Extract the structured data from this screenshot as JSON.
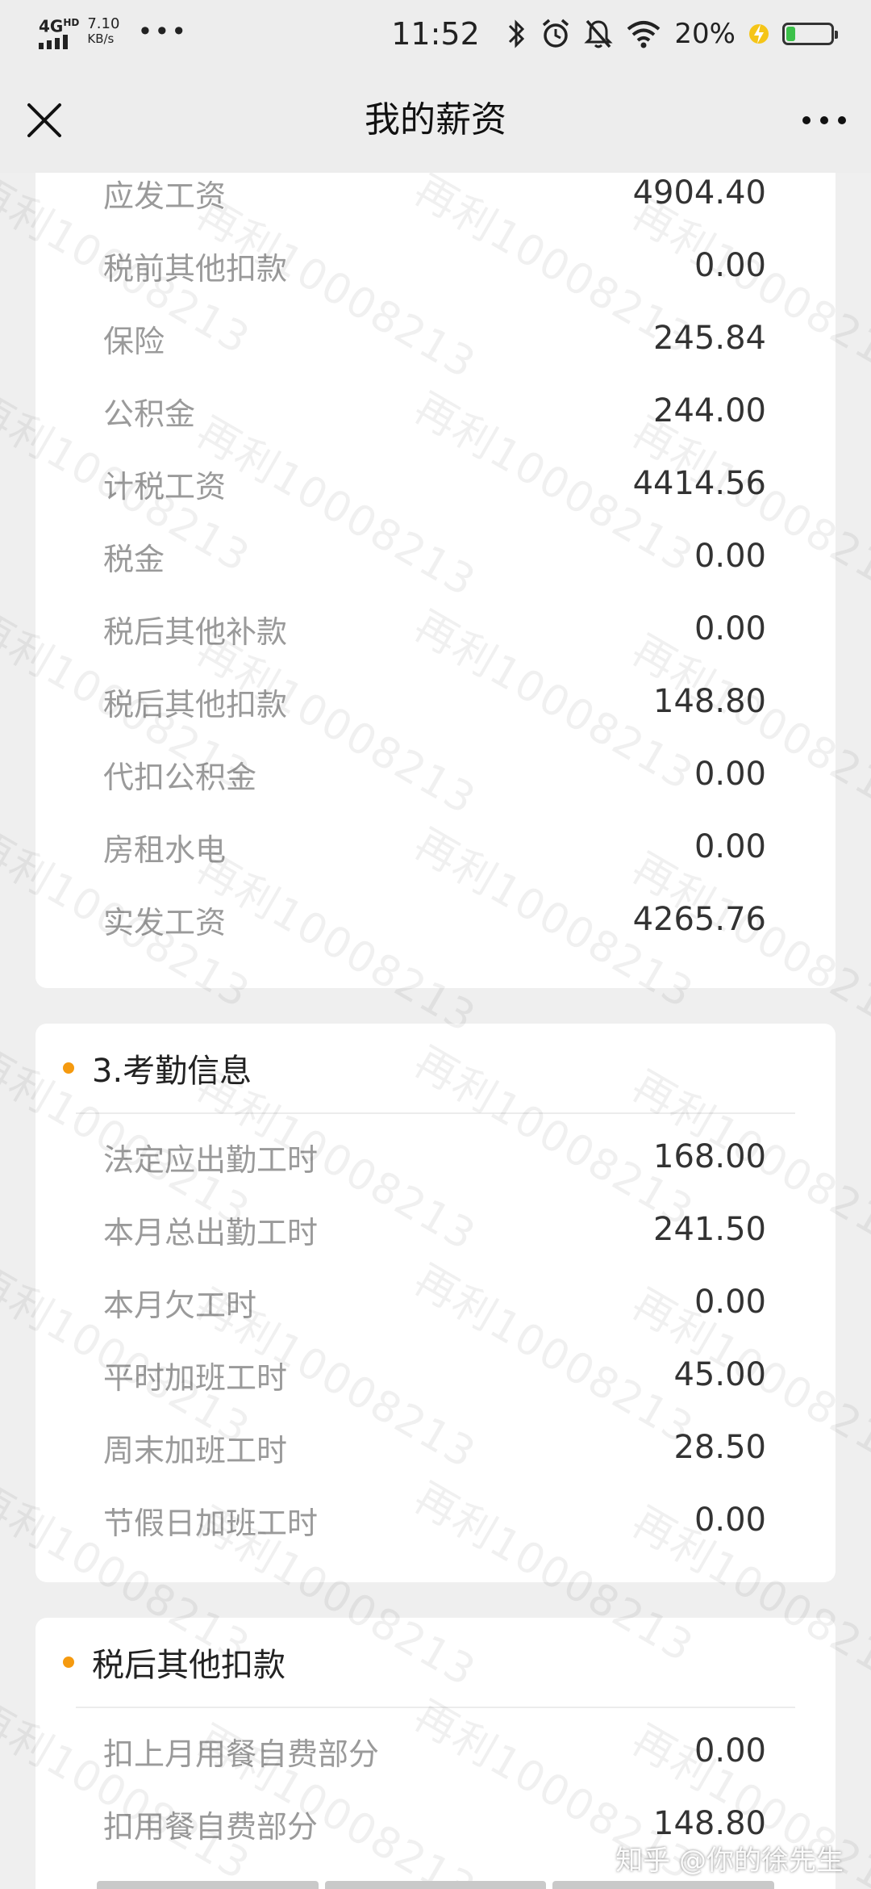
{
  "status_bar": {
    "network": "4G",
    "network_sup": "HD",
    "speed_value": "7.10",
    "speed_unit": "KB/s",
    "dots": "•••",
    "time": "11:52",
    "battery_pct": "20%",
    "battery_level": 0.2,
    "battery_color": "#3cc14a",
    "icons": [
      "bluetooth-icon",
      "alarm-icon",
      "mute-icon",
      "wifi-icon",
      "charging-icon"
    ]
  },
  "nav": {
    "title": "我的薪资",
    "close_icon": "close-icon",
    "more_icon": "more-icon"
  },
  "salary": {
    "rows": [
      {
        "label": "应发工资",
        "value": "4904.40"
      },
      {
        "label": "税前其他扣款",
        "value": "0.00"
      },
      {
        "label": "保险",
        "value": "245.84"
      },
      {
        "label": "公积金",
        "value": "244.00"
      },
      {
        "label": "计税工资",
        "value": "4414.56"
      },
      {
        "label": "税金",
        "value": "0.00"
      },
      {
        "label": "税后其他补款",
        "value": "0.00"
      },
      {
        "label": "税后其他扣款",
        "value": "148.80"
      },
      {
        "label": "代扣公积金",
        "value": "0.00"
      },
      {
        "label": "房租水电",
        "value": "0.00"
      },
      {
        "label": "实发工资",
        "value": "4265.76"
      }
    ]
  },
  "attendance": {
    "title": "3.考勤信息",
    "rows": [
      {
        "label": "法定应出勤工时",
        "value": "168.00"
      },
      {
        "label": "本月总出勤工时",
        "value": "241.50"
      },
      {
        "label": "本月欠工时",
        "value": "0.00"
      },
      {
        "label": "平时加班工时",
        "value": "45.00"
      },
      {
        "label": "周末加班工时",
        "value": "28.50"
      },
      {
        "label": "节假日加班工时",
        "value": "0.00"
      }
    ]
  },
  "deductions": {
    "title": "税后其他扣款",
    "rows": [
      {
        "label": "扣上月用餐自费部分",
        "value": "0.00"
      },
      {
        "label": "扣用餐自费部分",
        "value": "148.80"
      }
    ]
  },
  "watermark": "再利10008213",
  "credit": "知乎 @你的徐先生",
  "accent_color": "#f59a0f"
}
